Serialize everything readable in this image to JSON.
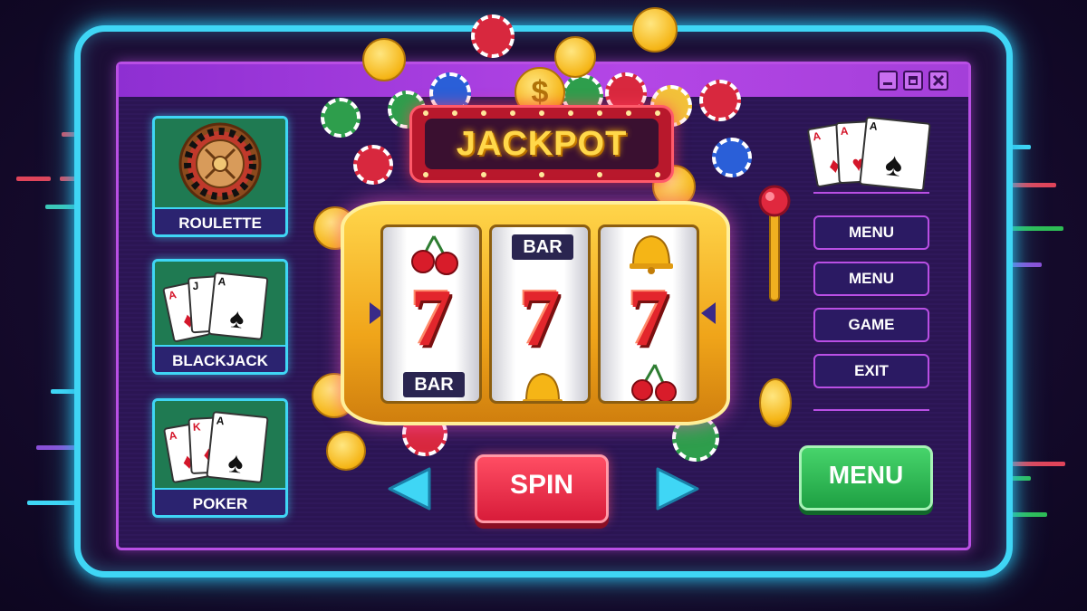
{
  "games": [
    {
      "label": "ROULETTE",
      "icon": "roulette-wheel-icon"
    },
    {
      "label": "BLACKJACK",
      "icon": "blackjack-cards-icon"
    },
    {
      "label": "POKER",
      "icon": "poker-cards-icon"
    }
  ],
  "sign": {
    "label": "JACKPOT",
    "coin_symbol": "$"
  },
  "reels": [
    {
      "top_symbol": "cherries-icon",
      "middle": "7",
      "bottom": "BAR"
    },
    {
      "top_symbol": "BAR",
      "middle": "7",
      "bottom_symbol": "bell-icon"
    },
    {
      "top_symbol": "bell-icon",
      "middle": "7",
      "bottom_symbol": "cherries-icon"
    }
  ],
  "spin_label": "SPIN",
  "side_menu": [
    "MENU",
    "MENU",
    "GAME",
    "EXIT"
  ],
  "green_button_label": "MENU",
  "cards": {
    "ace": "A",
    "jack": "J",
    "king": "K",
    "suit_spade": "♠",
    "suit_heart": "♥",
    "suit_diamond": "♦"
  },
  "colors": {
    "neon_frame": "#3fd6f5",
    "window_border": "#b94fe4",
    "spin": "#e02845",
    "menu_green": "#2ebc55",
    "jackpot_text": "#ffd84a"
  }
}
